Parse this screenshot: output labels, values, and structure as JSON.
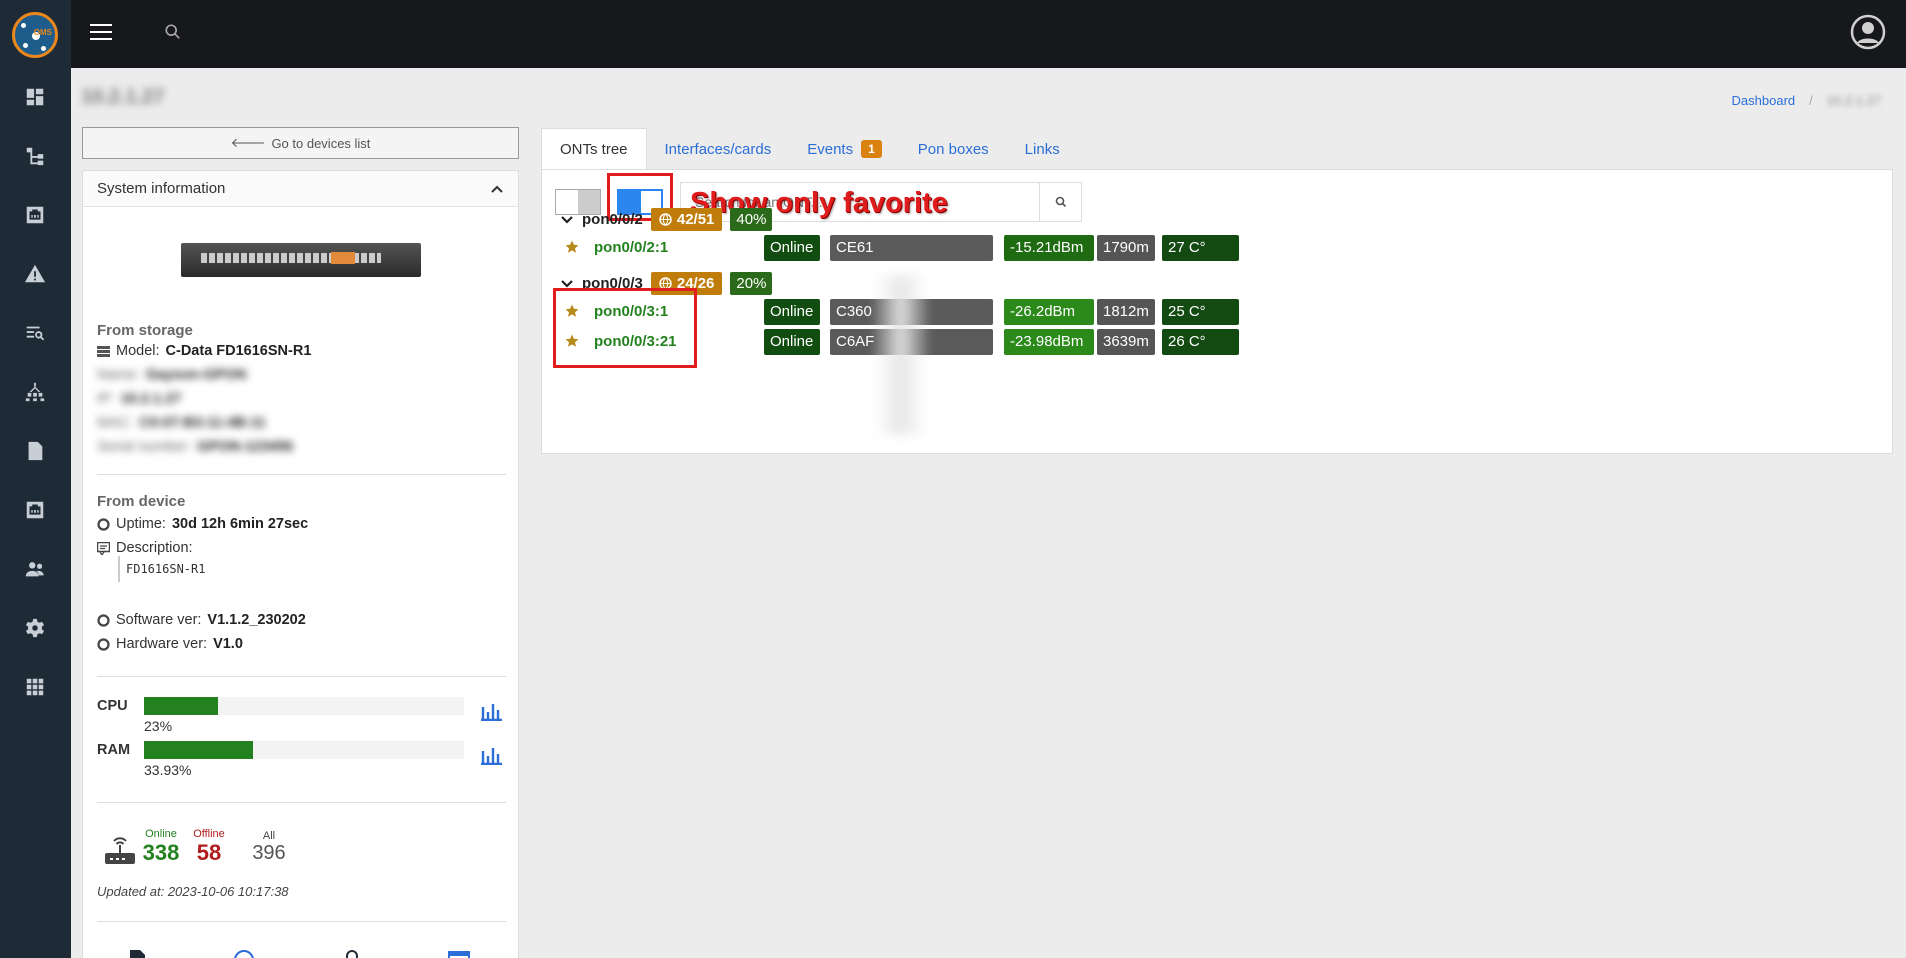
{
  "app": {
    "logo_text": "OMS"
  },
  "sidebar": {
    "items": [
      {
        "icon": "dashboard-icon"
      },
      {
        "icon": "tree-icon"
      },
      {
        "icon": "ethernet-icon"
      },
      {
        "icon": "warning-icon"
      },
      {
        "icon": "search-list-icon"
      },
      {
        "icon": "network-icon"
      },
      {
        "icon": "document-icon"
      },
      {
        "icon": "ethernet-icon"
      },
      {
        "icon": "users-icon"
      },
      {
        "icon": "settings-icon"
      },
      {
        "icon": "apps-icon"
      }
    ]
  },
  "header": {
    "title": "10.2.1.27",
    "breadcrumb": {
      "link": "Dashboard",
      "current": "10.2.1.27"
    }
  },
  "left": {
    "back_label": "Go to devices list",
    "info_title": "System information",
    "from_storage": "From storage",
    "model_label": "Model:",
    "model_value": "C-Data FD1616SN-R1",
    "name_label": "Name:",
    "name_value": "Gayson-GPON",
    "ip_label": "IP:",
    "ip_value": "10.2.1.27",
    "mac_label": "MAC:",
    "mac_value": "C0:07:B3:11:4B:11",
    "serial_label": "Serial number:",
    "serial_value": "GPON-123456",
    "from_device": "From device",
    "uptime_label": "Uptime:",
    "uptime_value": "30d 12h 6min 27sec",
    "description_label": "Description:",
    "description_value": "FD1616SN-R1",
    "software_label": "Software ver:",
    "software_value": "V1.1.2_230202",
    "hardware_label": "Hardware ver:",
    "hardware_value": "V1.0",
    "cpu_label": "CPU",
    "cpu_value": "23%",
    "cpu_percent": 23,
    "ram_label": "RAM",
    "ram_value": "33.93%",
    "ram_percent": 33.93,
    "online_label": "Online",
    "online_count": "338",
    "offline_label": "Offline",
    "offline_count": "58",
    "all_label": "All",
    "all_count": "396",
    "updated": "Updated at: 2023-10-06 10:17:38"
  },
  "tabs": [
    {
      "label": "ONTs tree"
    },
    {
      "label": "Interfaces/cards"
    },
    {
      "label": "Events",
      "badge": "1"
    },
    {
      "label": "Pon boxes"
    },
    {
      "label": "Links"
    }
  ],
  "onts": {
    "search_placeholder": "Search for an ONT...",
    "annotation": "Show only favorite",
    "groups": [
      {
        "name": "pon0/0/2",
        "count": "42/51",
        "percent": "40%",
        "rows": [
          {
            "name": "pon0/0/2:1",
            "status": "Online",
            "id": "CE61",
            "dbm": "-15.21dBm",
            "dist": "1790m",
            "temp": "27 C°"
          }
        ]
      },
      {
        "name": "pon0/0/3",
        "count": "24/26",
        "percent": "20%",
        "rows": [
          {
            "name": "pon0/0/3:1",
            "status": "Online",
            "id": "C360",
            "dbm": "-26.2dBm",
            "dist": "1812m",
            "temp": "25 C°"
          },
          {
            "name": "pon0/0/3:21",
            "status": "Online",
            "id": "C6AF",
            "dbm": "-23.98dBm",
            "dist": "3639m",
            "temp": "26 C°"
          }
        ]
      }
    ]
  },
  "colors": {
    "accent": "#2b6ed8",
    "highlight": "#e01c1c",
    "online": "#23821f",
    "offline": "#b11c1c"
  }
}
